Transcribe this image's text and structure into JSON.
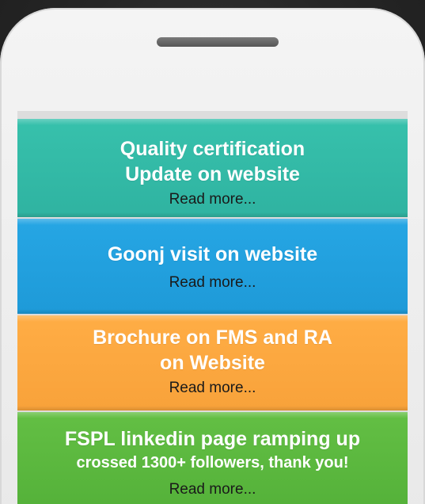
{
  "cards": [
    {
      "title_line1": "Quality certification",
      "title_line2": "Update on website",
      "link": "Read more...",
      "color": "#34bca8"
    },
    {
      "title_line1": "Goonj visit on website",
      "link": "Read more...",
      "color": "#22a1df"
    },
    {
      "title_line1": "Brochure on FMS and RA",
      "title_line2": "on Website",
      "link": "Read more...",
      "color": "#fca940"
    },
    {
      "title_line1": "FSPL linkedin page ramping up",
      "subtitle": "crossed 1300+ followers, thank you!",
      "link": "Read more...",
      "color": "#5cb940"
    }
  ]
}
